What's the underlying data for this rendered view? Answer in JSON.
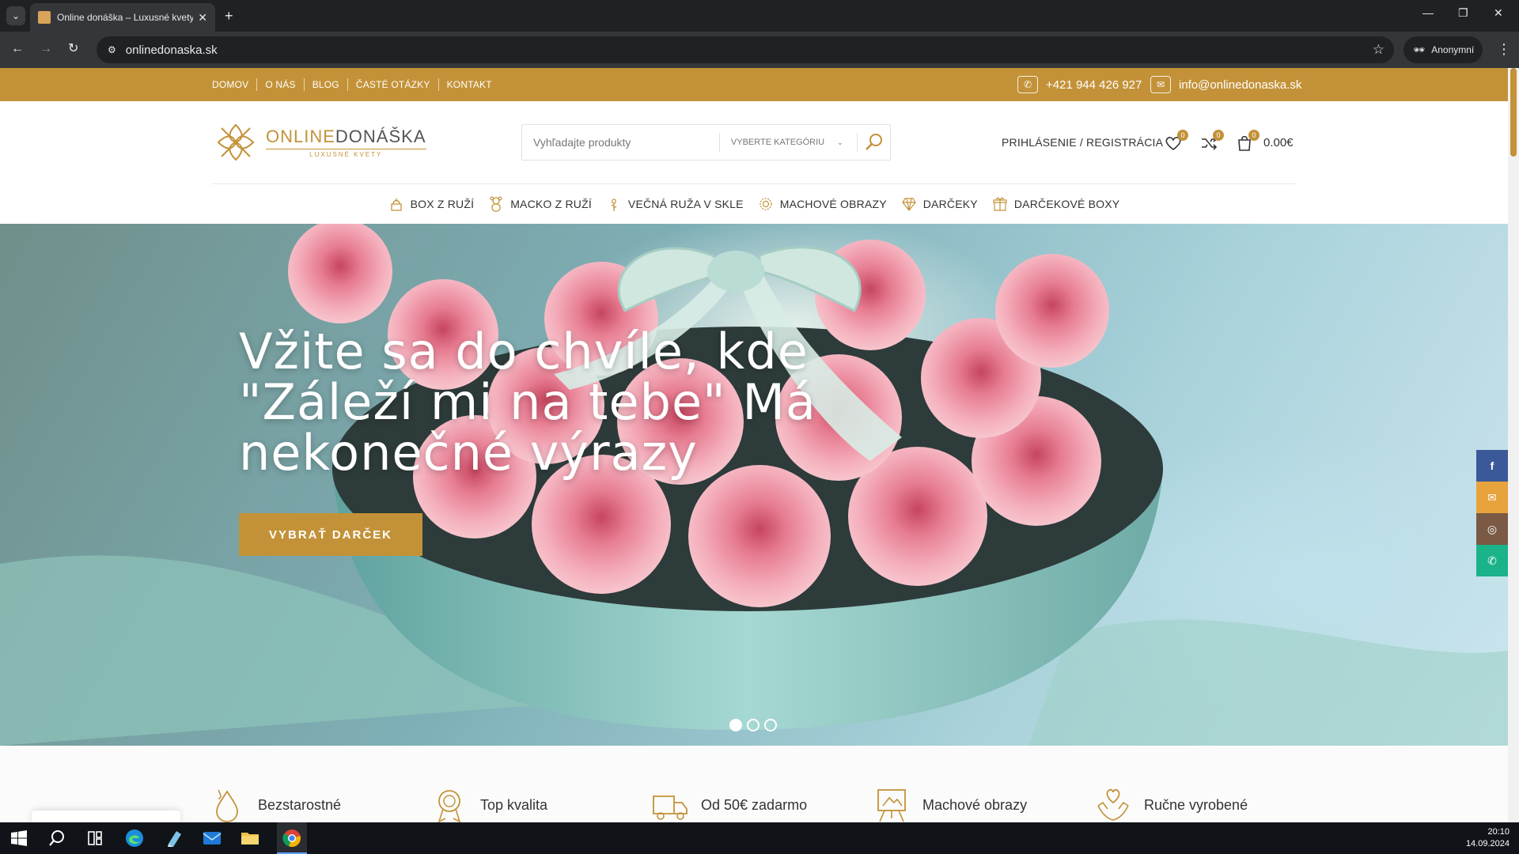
{
  "browser": {
    "tab_title": "Online donáška – Luxusné kvety",
    "url": "onlinedonaska.sk",
    "profile_label": "Anonymní"
  },
  "topbar": {
    "nav": [
      "DOMOV",
      "O NÁS",
      "BLOG",
      "ČASTÉ OTÁZKY",
      "KONTAKT"
    ],
    "phone": "+421 944 426 927",
    "email": "info@onlinedonaska.sk"
  },
  "header": {
    "logo_part1": "ONLINE",
    "logo_part2": "DONÁŠKA",
    "logo_tagline": "LUXUSNÉ KVETY",
    "search_placeholder": "Vyhľadajte produkty",
    "category_label": "VYBERTE KATEGÓRIU",
    "account_label": "PRIHLÁSENIE / REGISTRÁCIA",
    "wishlist_count": "0",
    "compare_count": "0",
    "cart_count": "0",
    "cart_total": "0.00€"
  },
  "main_nav": [
    "BOX Z RUŽÍ",
    "MACKO Z RUŽÍ",
    "VEČNÁ RUŽA V SKLE",
    "MACHOVÉ OBRAZY",
    "DARČEKY",
    "DARČEKOVÉ BOXY"
  ],
  "hero": {
    "title_line1": "Vžite sa do chvíle, kde",
    "title_line2": "\"Záleží mi na tebe\" Má",
    "title_line3": "nekonečné výrazy",
    "button_label": "VYBRAŤ DARČEK",
    "slide_count": 3,
    "active_slide": 1
  },
  "features": [
    "Bezstarostné",
    "Top kvalita",
    "Od 50€ zadarmo",
    "Machové obrazy",
    "Ručne vyrobené"
  ],
  "social_colors": {
    "facebook": "#3b5998",
    "email": "#e8a33d",
    "instagram": "#7a5a45",
    "whatsapp": "#1bb38a"
  },
  "colors": {
    "brand": "#c39238"
  },
  "taskbar": {
    "time": "20:10",
    "date": "14.09.2024"
  }
}
